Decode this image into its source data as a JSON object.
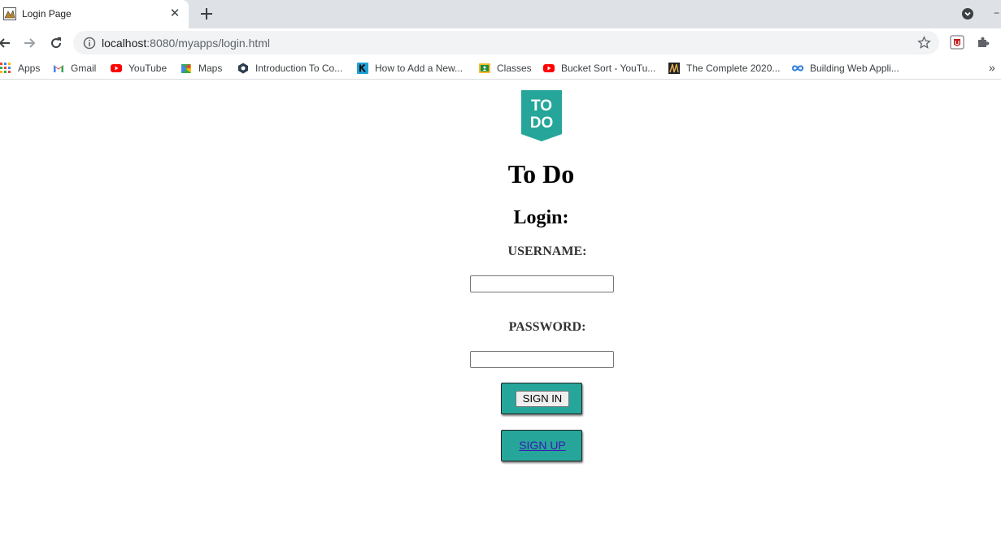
{
  "browser": {
    "tab": {
      "title": "Login Page",
      "close_glyph": "✕"
    },
    "new_tab_icon": "plus-icon",
    "url": {
      "host": "localhost",
      "rest": ":8080/myapps/login.html"
    },
    "bookmarks": [
      {
        "label": "Apps",
        "icon": "apps-grid-icon"
      },
      {
        "label": "Gmail",
        "icon": "gmail-icon"
      },
      {
        "label": "YouTube",
        "icon": "youtube-icon"
      },
      {
        "label": "Maps",
        "icon": "maps-icon"
      },
      {
        "label": "Introduction To Co...",
        "icon": "hexagon-icon"
      },
      {
        "label": "How to Add a New...",
        "icon": "k-icon"
      },
      {
        "label": "Classes",
        "icon": "classroom-icon"
      },
      {
        "label": "Bucket Sort - YouTu...",
        "icon": "youtube-icon"
      },
      {
        "label": "The Complete 2020...",
        "icon": "course-icon"
      },
      {
        "label": "Building Web Appli...",
        "icon": "infinity-icon"
      }
    ],
    "bookmarks_more": "»"
  },
  "page": {
    "logo_text_top": "TO",
    "logo_text_bottom": "DO",
    "logo_color": "#26a69a",
    "app_title": "To Do",
    "login_heading": "Login:",
    "username_label": "USERNAME:",
    "username_value": "",
    "password_label": "PASSWORD:",
    "password_value": "",
    "signin_label": "SIGN IN",
    "signup_label": "SIGN UP",
    "button_color": "#26a69a"
  }
}
